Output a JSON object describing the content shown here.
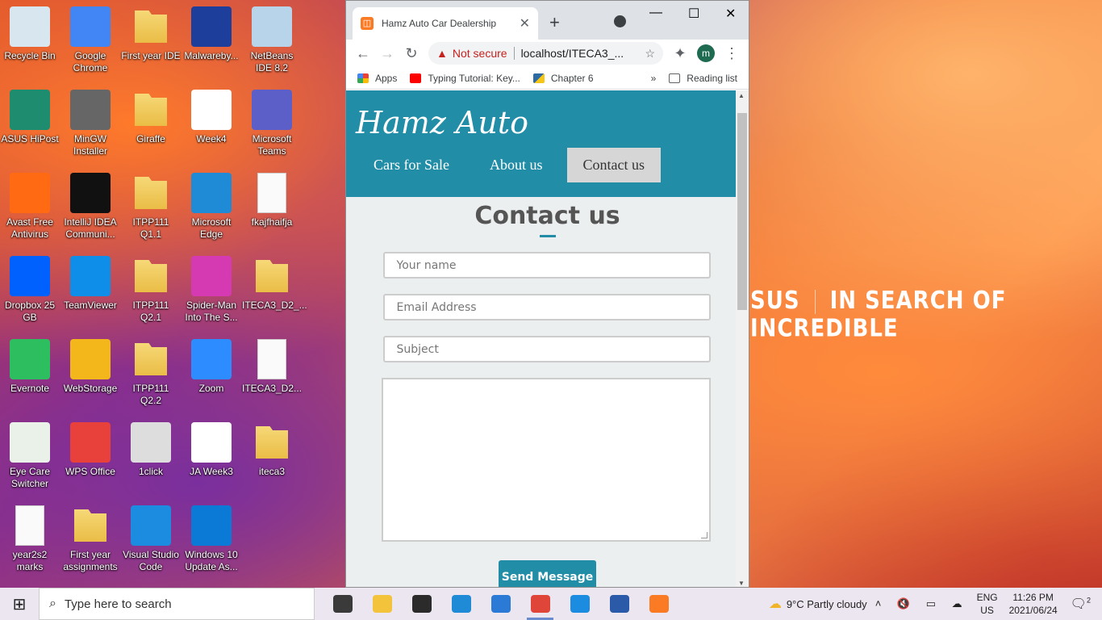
{
  "desktop": {
    "icons": [
      {
        "label": "Recycle Bin",
        "kind": "recycle"
      },
      {
        "label": "Google Chrome",
        "kind": "chrome"
      },
      {
        "label": "First year IDE",
        "kind": "folder"
      },
      {
        "label": "Malwareby...",
        "kind": "malwarebytes"
      },
      {
        "label": "NetBeans IDE 8.2",
        "kind": "netbeans"
      },
      {
        "label": "ASUS HiPost",
        "kind": "asus"
      },
      {
        "label": "MinGW Installer",
        "kind": "mingw"
      },
      {
        "label": "Giraffe",
        "kind": "folder"
      },
      {
        "label": "Week4",
        "kind": "ppt"
      },
      {
        "label": "Microsoft Teams",
        "kind": "teams"
      },
      {
        "label": "Avast Free Antivirus",
        "kind": "avast"
      },
      {
        "label": "IntelliJ IDEA Communi...",
        "kind": "intellij"
      },
      {
        "label": "ITPP111 Q1.1",
        "kind": "folder"
      },
      {
        "label": "Microsoft Edge",
        "kind": "edge"
      },
      {
        "label": "fkajfhaifja",
        "kind": "doc"
      },
      {
        "label": "Dropbox 25 GB",
        "kind": "dropbox"
      },
      {
        "label": "TeamViewer",
        "kind": "teamviewer"
      },
      {
        "label": "ITPP111 Q2.1",
        "kind": "folder"
      },
      {
        "label": "Spider-Man Into The S...",
        "kind": "video"
      },
      {
        "label": "ITECA3_D2_...",
        "kind": "folder"
      },
      {
        "label": "Evernote",
        "kind": "evernote"
      },
      {
        "label": "WebStorage",
        "kind": "webstorage"
      },
      {
        "label": "ITPP111 Q2.2",
        "kind": "folder"
      },
      {
        "label": "Zoom",
        "kind": "zoom"
      },
      {
        "label": "ITECA3_D2...",
        "kind": "doc"
      },
      {
        "label": "Eye Care Switcher",
        "kind": "eyecare"
      },
      {
        "label": "WPS Office",
        "kind": "wps"
      },
      {
        "label": "1click",
        "kind": "oneclick"
      },
      {
        "label": "JA Week3",
        "kind": "ppt"
      },
      {
        "label": "iteca3",
        "kind": "folder"
      },
      {
        "label": "year2s2 marks",
        "kind": "doc"
      },
      {
        "label": "First year assignments",
        "kind": "folder"
      },
      {
        "label": "Visual Studio Code",
        "kind": "vscode"
      },
      {
        "label": "Windows 10 Update As...",
        "kind": "winupdate"
      }
    ],
    "wallpaper_brand": "SUS",
    "wallpaper_slogan": "IN SEARCH OF INCREDIBLE"
  },
  "browser": {
    "tab_title": "Hamz Auto Car Dealership",
    "tab_close": "✕",
    "new_tab": "+",
    "window_controls": {
      "minimize": "—",
      "maximize": "☐",
      "close": "✕"
    },
    "security_label": "Not secure",
    "url": "localhost/ITECA3_...",
    "profile_initial": "m",
    "bookmarks": [
      {
        "label": "Apps",
        "color": "#ea4335"
      },
      {
        "label": "Typing Tutorial: Key...",
        "color": "#ff0000"
      },
      {
        "label": "Chapter 6",
        "color": "#2d6aa3"
      }
    ],
    "bookmarks_more": "»",
    "reading_list": "Reading list"
  },
  "site": {
    "brand": "Hamz Auto",
    "nav": [
      {
        "label": "Cars for Sale",
        "active": false
      },
      {
        "label": "About us",
        "active": false
      },
      {
        "label": "Contact us",
        "active": true
      }
    ],
    "contact_title": "Contact us",
    "form": {
      "name_placeholder": "Your name",
      "email_placeholder": "Email Address",
      "subject_placeholder": "Subject",
      "message_value": "",
      "submit_label": "Send Message"
    },
    "accent_color": "#228da6"
  },
  "taskbar": {
    "search_placeholder": "Type here to search",
    "weather": "9°C  Partly cloudy",
    "lang_top": "ENG",
    "lang_bottom": "US",
    "time": "11:26 PM",
    "date": "2021/06/24",
    "notification_count": "2",
    "apps": [
      {
        "name": "task-view",
        "color": "#3a3a3a"
      },
      {
        "name": "file-explorer",
        "color": "#f3c33c"
      },
      {
        "name": "store",
        "color": "#2b2b2b"
      },
      {
        "name": "edge",
        "color": "#1f8bd6"
      },
      {
        "name": "mail",
        "color": "#2a7ad6"
      },
      {
        "name": "chrome",
        "color": "#e0453a",
        "active": true
      },
      {
        "name": "vscode",
        "color": "#1b8ce0"
      },
      {
        "name": "word",
        "color": "#2b5aa8"
      },
      {
        "name": "xampp",
        "color": "#fb7a24"
      }
    ]
  }
}
